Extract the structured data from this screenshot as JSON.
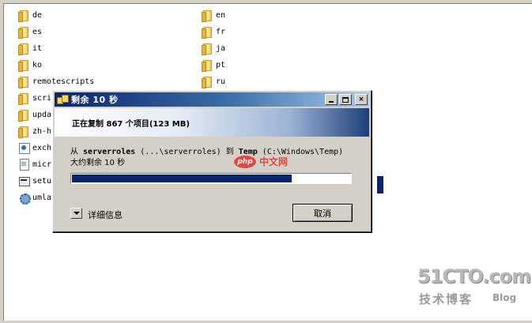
{
  "explorer": {
    "left_column": [
      {
        "label": "de",
        "icon": "folder-icon"
      },
      {
        "label": "es",
        "icon": "folder-icon"
      },
      {
        "label": "it",
        "icon": "folder-icon"
      },
      {
        "label": "ko",
        "icon": "folder-icon"
      },
      {
        "label": "remotescripts",
        "icon": "folder-icon"
      },
      {
        "label": "scri",
        "icon": "folder-icon"
      },
      {
        "label": "upda",
        "icon": "folder-icon"
      },
      {
        "label": "zh-h",
        "icon": "folder-icon"
      },
      {
        "label": "exch",
        "icon": "exe-icon"
      },
      {
        "label": "micr",
        "icon": "document-icon"
      },
      {
        "label": "setu",
        "icon": "setup-icon"
      },
      {
        "label": "umla",
        "icon": "gear-icon"
      }
    ],
    "right_column": [
      {
        "label": "en",
        "icon": "folder-icon"
      },
      {
        "label": "fr",
        "icon": "folder-icon"
      },
      {
        "label": "ja",
        "icon": "folder-icon"
      },
      {
        "label": "pt",
        "icon": "folder-icon"
      },
      {
        "label": "ru",
        "icon": "folder-icon"
      }
    ]
  },
  "dialog": {
    "title": "剩余 10 秒",
    "header": "正在复制 867 个项目(123 MB)",
    "from_prefix": "从 ",
    "from_source": "serverroles",
    "from_source_path": " (...\\serverroles) 到 ",
    "from_dest": "Temp",
    "from_dest_path": " (C:\\Windows\\Temp)",
    "time_remaining": "大约剩余 10 秒",
    "progress_percent": 79,
    "details_label": "详细信息",
    "cancel_label": "取消",
    "minimize_icon": "minimize-icon",
    "maximize_icon": "maximize-icon",
    "close_label": "×"
  },
  "watermarks": {
    "php_badge": "php",
    "php_text": "中文网",
    "cto_logo": "51CTO.com",
    "cto_cn": "技术博客",
    "cto_blog": "Blog"
  },
  "colors": {
    "titlebar_start": "#0a246a",
    "titlebar_end": "#a6caf0",
    "progress_fill": "#0a246a",
    "window_face": "#d4d0c8"
  }
}
